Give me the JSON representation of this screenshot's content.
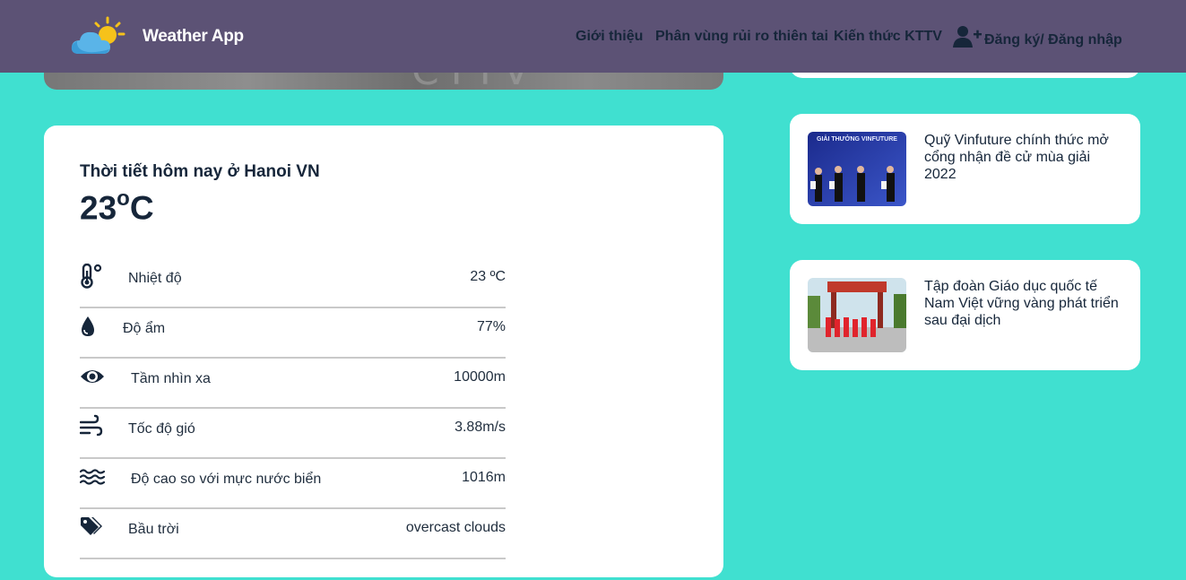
{
  "header": {
    "app_title": "Weather App",
    "nav": [
      "Giới thiệu",
      "Phân vùng rủi ro thiên tai",
      "Kiến thức KTTV"
    ],
    "login_label": "Đăng ký/ Đăng nhập",
    "background": "#5c5275"
  },
  "hero": {
    "ghost_text": "CTTV"
  },
  "weather": {
    "heading": "Thời tiết hôm nay ở Hanoi VN",
    "temp_value": "23",
    "temp_unit_sup": "o",
    "temp_unit": "C",
    "rows": [
      {
        "icon": "thermometer-icon",
        "label": "Nhiệt độ",
        "value": "23 ºC"
      },
      {
        "icon": "droplet-icon",
        "label": "Độ ẩm",
        "value": "77%"
      },
      {
        "icon": "eye-icon",
        "label": "Tầm nhìn xa",
        "value": "10000m"
      },
      {
        "icon": "wind-icon",
        "label": "Tốc độ gió",
        "value": "3.88m/s"
      },
      {
        "icon": "water-waves-icon",
        "label": "Độ cao so với mực nước biển",
        "value": "1016m"
      },
      {
        "icon": "tags-icon",
        "label": "Bầu trời",
        "value": "overcast clouds"
      }
    ]
  },
  "news": [
    {
      "title": "Quỹ Vinfuture chính thức mở cổng nhận đề cử mùa giải 2022",
      "thumb_text": "GIẢI THƯỞNG VINFUTURE"
    },
    {
      "title": "Tập đoàn Giáo dục quốc tế Nam Việt vững vàng phát triển sau đại dịch"
    }
  ],
  "colors": {
    "page_bg": "#40e0d0",
    "card_bg": "#ffffff",
    "text": "#16263a"
  }
}
